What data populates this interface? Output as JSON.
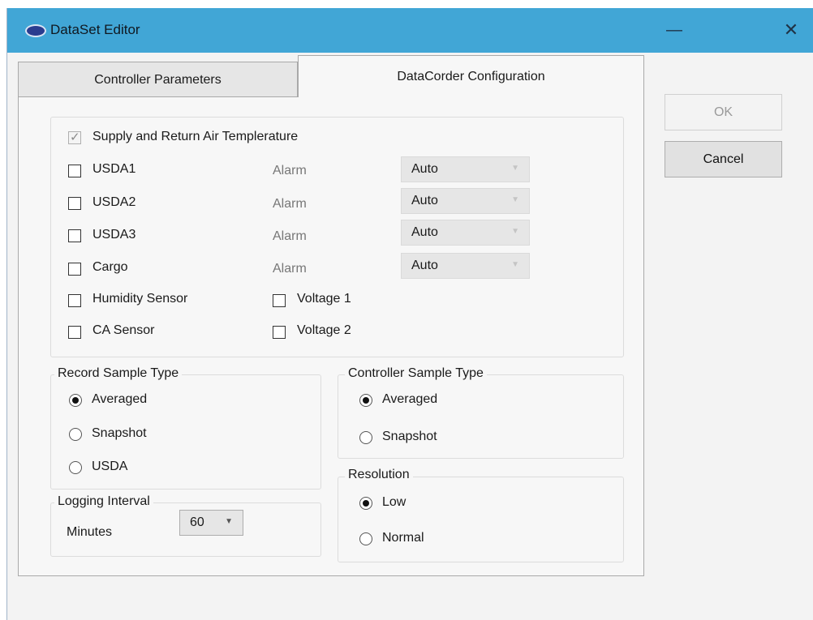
{
  "window": {
    "title": "DataSet Editor",
    "minimize_glyph": "—",
    "close_glyph": "✕",
    "app_icon": "carrier-logo-icon"
  },
  "tabs": [
    {
      "label": "Controller Parameters",
      "selected": false
    },
    {
      "label": "DataCorder Configuration",
      "selected": true
    }
  ],
  "sensors": {
    "supply_return": {
      "label": "Supply and Return Air Templerature",
      "checked": true,
      "enabled": false
    },
    "usda1": {
      "label": "USDA1",
      "checked": false,
      "alarm_label": "Alarm",
      "alarm_value": "Auto"
    },
    "usda2": {
      "label": "USDA2",
      "checked": false,
      "alarm_label": "Alarm",
      "alarm_value": "Auto"
    },
    "usda3": {
      "label": "USDA3",
      "checked": false,
      "alarm_label": "Alarm",
      "alarm_value": "Auto"
    },
    "cargo": {
      "label": "Cargo",
      "checked": false,
      "alarm_label": "Alarm",
      "alarm_value": "Auto"
    },
    "humidity": {
      "label": "Humidity Sensor",
      "checked": false
    },
    "voltage1": {
      "label": "Voltage 1",
      "checked": false
    },
    "ca": {
      "label": "CA Sensor",
      "checked": false
    },
    "voltage2": {
      "label": "Voltage 2",
      "checked": false
    }
  },
  "record_sample": {
    "title": "Record Sample Type",
    "options": [
      "Averaged",
      "Snapshot",
      "USDA"
    ],
    "selected": "Averaged"
  },
  "controller_sample": {
    "title": "Controller Sample Type",
    "options": [
      "Averaged",
      "Snapshot"
    ],
    "selected": "Averaged"
  },
  "resolution": {
    "title": "Resolution",
    "options": [
      "Low",
      "Normal"
    ],
    "selected": "Low"
  },
  "logging": {
    "title": "Logging Interval",
    "minutes_label": "Minutes",
    "minutes_value": "60"
  },
  "buttons": {
    "ok": "OK",
    "cancel": "Cancel",
    "ok_enabled": false
  },
  "colors": {
    "titlebar": "#41a6d6",
    "panel": "#f7f7f7",
    "button_face": "#e1e1e1"
  }
}
